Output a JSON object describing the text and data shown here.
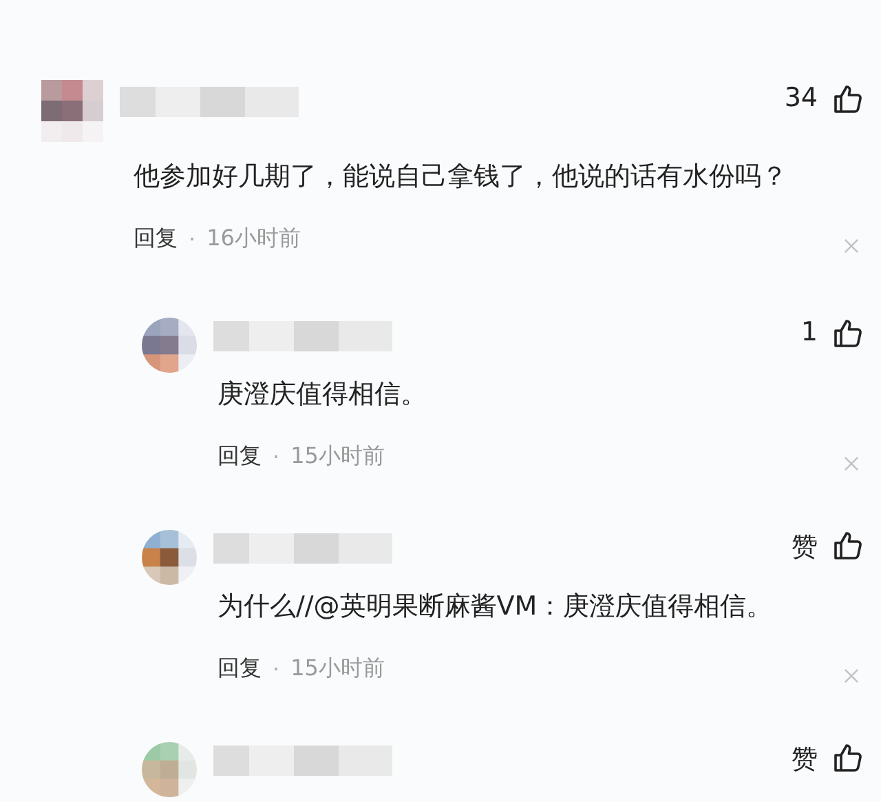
{
  "comments": [
    {
      "kind": "top",
      "likes": "34",
      "text": "他参加好几期了，能说自己拿钱了，他说的话有水份吗？",
      "reply_label": "回复",
      "separator": "·",
      "time": "16小时前"
    },
    {
      "kind": "reply",
      "likes": "1",
      "text": "庚澄庆值得相信。",
      "reply_label": "回复",
      "separator": "·",
      "time": "15小时前"
    },
    {
      "kind": "reply",
      "likes": "赞",
      "text": "为什么//@英明果断麻酱VM：庚澄庆值得相信。",
      "reply_label": "回复",
      "separator": "·",
      "time": "15小时前"
    },
    {
      "kind": "reply",
      "likes": "赞"
    }
  ]
}
